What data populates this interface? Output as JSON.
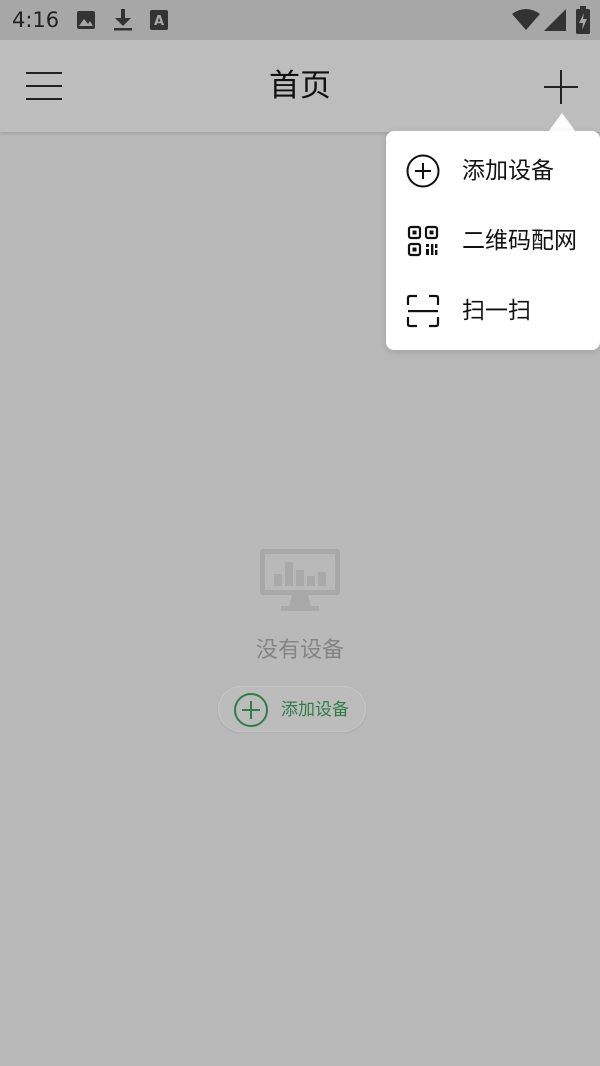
{
  "status_bar": {
    "time": "4:16",
    "icons": [
      "image-icon",
      "download-icon",
      "a-text-icon",
      "wifi-icon",
      "signal-icon",
      "battery-icon"
    ]
  },
  "app_bar": {
    "title": "首页",
    "menu_icon": "hamburger-menu-icon",
    "add_icon": "plus-icon"
  },
  "popup_menu": {
    "items": [
      {
        "label": "添加设备",
        "icon": "add-circle-icon"
      },
      {
        "label": "二维码配网",
        "icon": "qr-code-icon"
      },
      {
        "label": "扫一扫",
        "icon": "scan-icon"
      }
    ]
  },
  "empty_state": {
    "icon": "monitor-chart-icon",
    "message": "没有设备",
    "button_label": "添加设备",
    "button_icon": "add-circle-icon"
  },
  "colors": {
    "background": "#b9b9b9",
    "status_bar": "#a7a7a7",
    "popup": "#ffffff",
    "accent_green": "#2f7d4a",
    "empty_text": "#858585"
  }
}
